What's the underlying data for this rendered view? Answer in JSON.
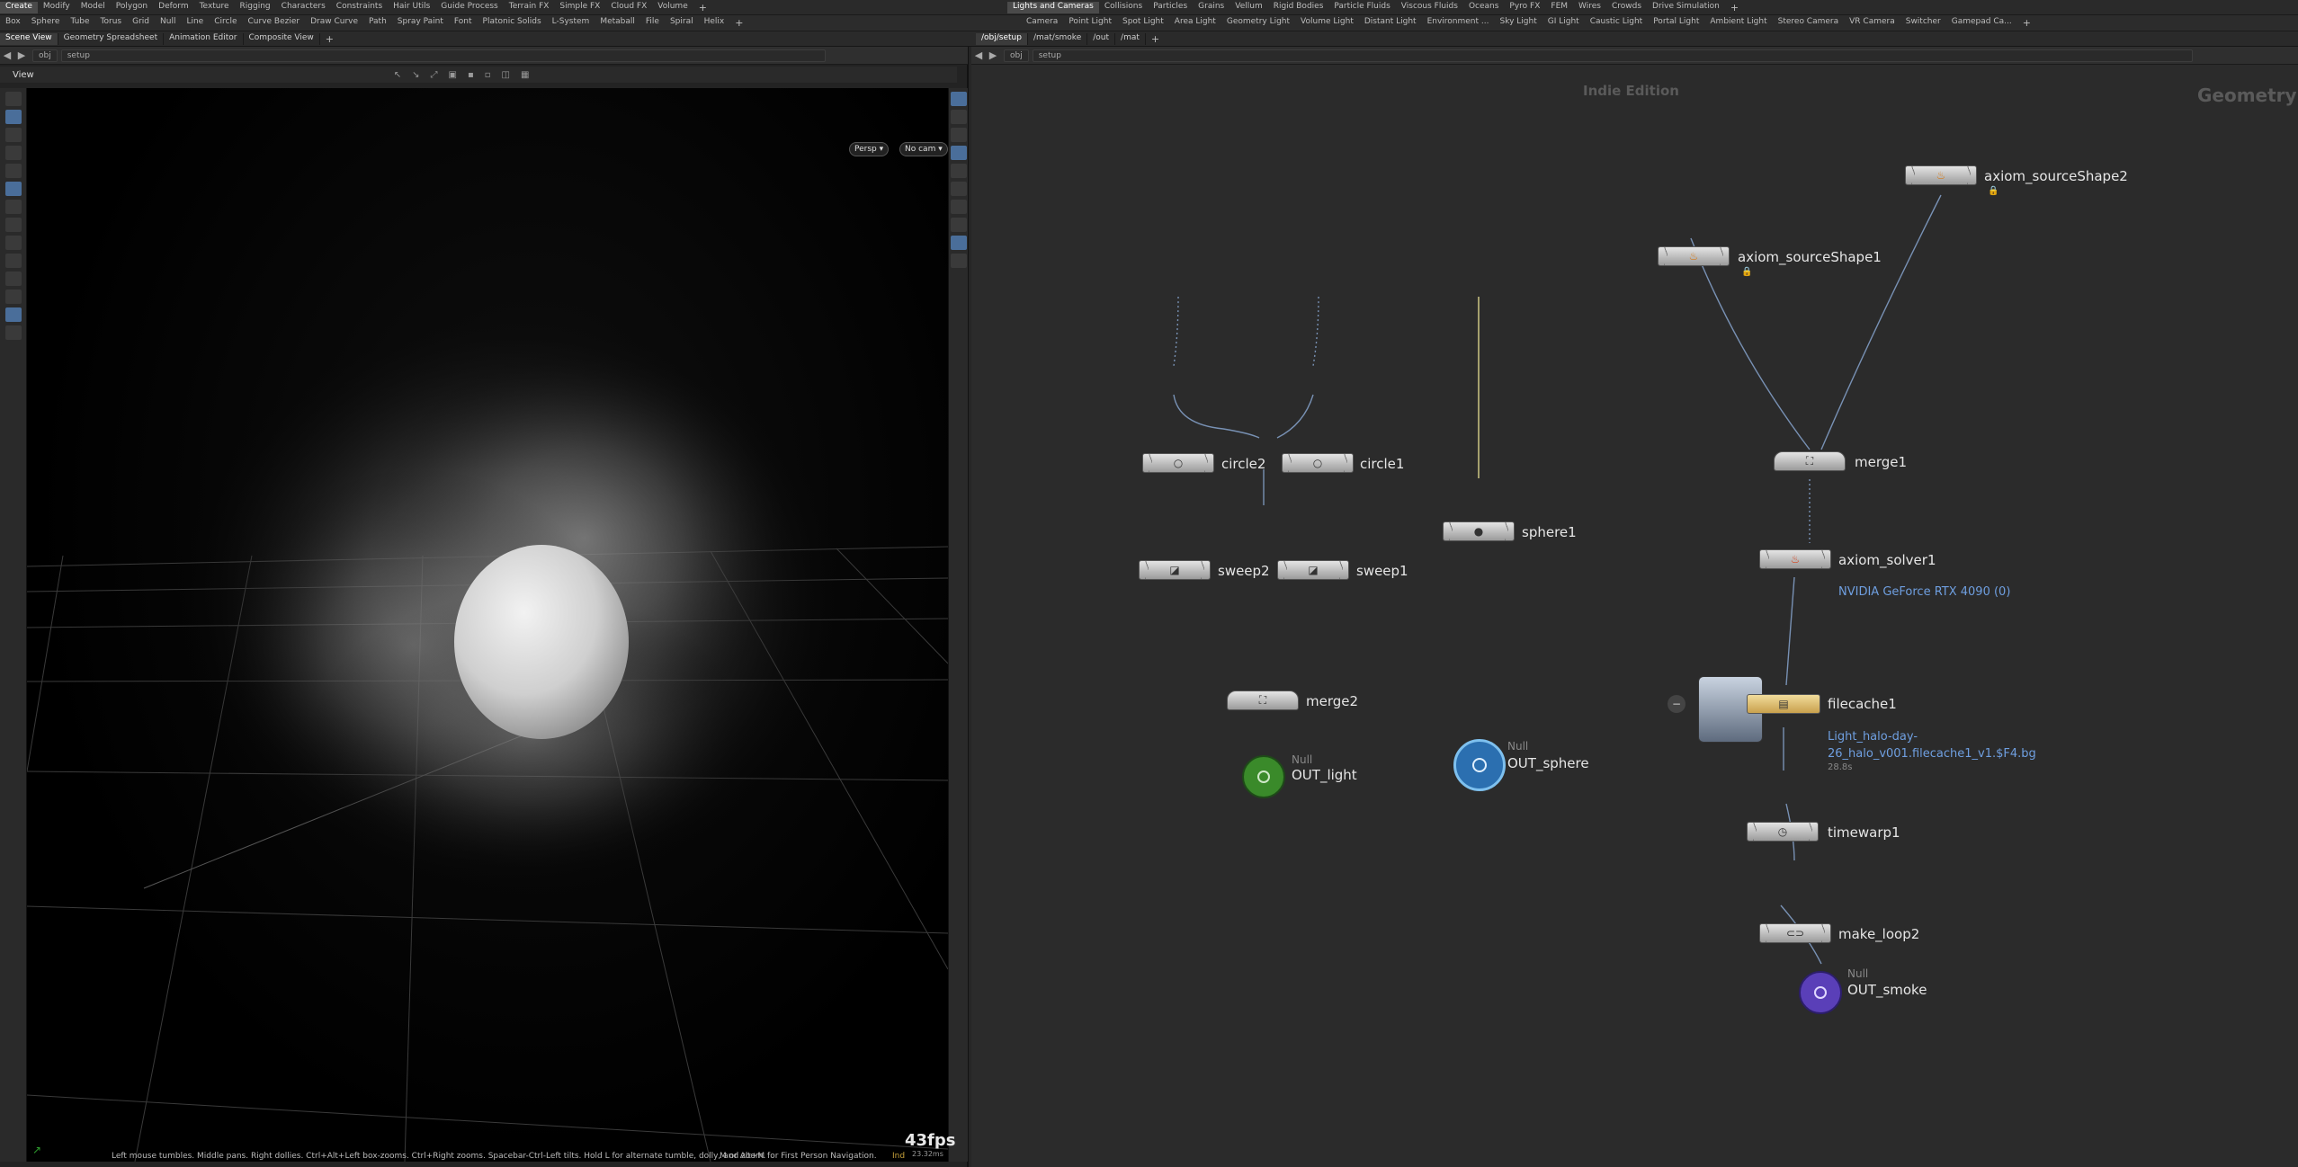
{
  "main_tabs": [
    "Create",
    "Modify",
    "Model",
    "Polygon",
    "Deform",
    "Texture",
    "Rigging",
    "Characters",
    "Constraints",
    "Hair Utils",
    "Guide Process",
    "Terrain FX",
    "Simple FX",
    "Cloud FX",
    "Volume"
  ],
  "tools": [
    "Box",
    "Sphere",
    "Tube",
    "Torus",
    "Grid",
    "Null",
    "Line",
    "Circle",
    "Curve Bezier",
    "Draw Curve",
    "Path",
    "Spray Paint",
    "Font",
    "Platonic Solids",
    "L-System",
    "Metaball",
    "File",
    "Spiral",
    "Helix"
  ],
  "right_tabs": [
    "Lights and Cameras",
    "Collisions",
    "Particles",
    "Grains",
    "Vellum",
    "Rigid Bodies",
    "Particle Fluids",
    "Viscous Fluids",
    "Oceans",
    "Pyro FX",
    "FEM",
    "Wires",
    "Crowds",
    "Drive Simulation"
  ],
  "right_tools": [
    "Camera",
    "Point Light",
    "Spot Light",
    "Area Light",
    "Geometry Light",
    "Volume Light",
    "Distant Light",
    "Environment ...",
    "Sky Light",
    "GI Light",
    "Caustic Light",
    "Portal Light",
    "Ambient Light",
    "Stereo Camera",
    "VR Camera",
    "Switcher",
    "Gamepad Ca..."
  ],
  "left_pane_tabs": [
    "Scene View",
    "Geometry Spreadsheet",
    "Animation Editor",
    "Composite View"
  ],
  "right_pane_tabs": [
    "/obj/setup",
    "/mat/smoke",
    "/out",
    "/mat"
  ],
  "left_path": {
    "root": "obj",
    "node": "setup"
  },
  "right_path": {
    "root": "obj",
    "node": "setup"
  },
  "viewport": {
    "title": "View",
    "persp": "Persp ▾",
    "cam": "No cam ▾",
    "fps": "43fps",
    "ms": "23.32ms",
    "hint": "Left mouse tumbles. Middle pans. Right dollies. Ctrl+Alt+Left box-zooms. Ctrl+Right zooms. Spacebar-Ctrl-Left tilts. Hold L for alternate tumble, dolly, and zoom.",
    "hint2": "M or Alt+M for First Person Navigation.",
    "ind": "Ind"
  },
  "network": {
    "watermark_left": "Indie Edition",
    "watermark_right": "Geometry",
    "nodes": {
      "circle2": "circle2",
      "circle1": "circle1",
      "sweep2": "sweep2",
      "sweep1": "sweep1",
      "merge2": "merge2",
      "out_light": "OUT_light",
      "sphere1": "sphere1",
      "out_sphere": "OUT_sphere",
      "axiom_source1": "axiom_sourceShape1",
      "axiom_source2": "axiom_sourceShape2",
      "merge1": "merge1",
      "axiom_solver1": "axiom_solver1",
      "filecache1": "filecache1",
      "timewarp1": "timewarp1",
      "make_loop2": "make_loop2",
      "out_smoke": "OUT_smoke"
    },
    "null_type": "Null",
    "gpu_info": "NVIDIA GeForce RTX 4090 (0)",
    "cache_path_1": "Light_halo-day-",
    "cache_path_2": "26_halo_v001.filecache1_v1.$F4.bg",
    "cache_size": "28.8s"
  },
  "colors": {
    "accent": "#4a6e9a",
    "null_green": "#3a8a2a",
    "null_blue": "#2b6fb0",
    "null_purple": "#5a3fb8",
    "info_link": "#6f9fe0"
  }
}
